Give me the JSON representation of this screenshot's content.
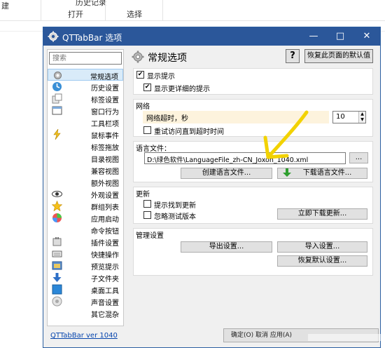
{
  "ribbon": {
    "left_label": "建",
    "history_label": "历史记录",
    "open_label": "打开",
    "select_label": "选择"
  },
  "dialog": {
    "title": "QTTabBar 选项",
    "minimize": "—",
    "maximize": "□",
    "close": "✕"
  },
  "sidebar": {
    "search_placeholder": "搜索",
    "items": [
      {
        "label": "常规选项",
        "icon": "gear-icon",
        "selected": true
      },
      {
        "label": "历史设置",
        "icon": "clock-icon"
      },
      {
        "label": "标签设置",
        "icon": "tabs-icon"
      },
      {
        "label": "窗口行为",
        "icon": "window-icon"
      },
      {
        "label": "工具栏项",
        "icon": "blank-icon"
      },
      {
        "label": "鼠标事件",
        "icon": "lightning-icon"
      },
      {
        "label": "标签拖放",
        "icon": "blank-icon"
      },
      {
        "label": "目录视图",
        "icon": "blank-icon"
      },
      {
        "label": "兼容视图",
        "icon": "blank-icon"
      },
      {
        "label": "额外视图",
        "icon": "blank-icon"
      },
      {
        "label": "外观设置",
        "icon": "eye-icon"
      },
      {
        "label": "群组列表",
        "icon": "star-icon"
      },
      {
        "label": "应用启动",
        "icon": "app-icon"
      },
      {
        "label": "命令按钮",
        "icon": "blank-icon"
      },
      {
        "label": "插件设置",
        "icon": "plugin-icon"
      },
      {
        "label": "快捷操作",
        "icon": "keyboard-icon"
      },
      {
        "label": "预览提示",
        "icon": "preview-icon"
      },
      {
        "label": "子文件夹",
        "icon": "arrow-down-icon"
      },
      {
        "label": "桌面工具",
        "icon": "desktop-icon"
      },
      {
        "label": "声音设置",
        "icon": "speaker-icon"
      },
      {
        "label": "其它混杂",
        "icon": "blank-icon"
      }
    ]
  },
  "header": {
    "title": "常规选项",
    "help_label": "?",
    "restore_label": "恢复此页面的默认值"
  },
  "tips": {
    "title": "显示提示",
    "checked": "✔",
    "show_detail": "显示更详细的提示"
  },
  "network": {
    "title": "网络",
    "timeout_label": "网络超时，秒",
    "timeout_value": "10",
    "retry_label": "重试访问直到超时时间"
  },
  "language": {
    "title": "语言文件：",
    "path": "D:\\绿色软件\\LanguageFile_zh-CN_Joxon_1040.xml",
    "browse_label": "...",
    "create_label": "创建语言文件...",
    "download_label": "下载语言文件..."
  },
  "update": {
    "title": "更新",
    "notify_label": "提示找到更新",
    "ignore_beta_label": "忽略测试版本",
    "download_now_label": "立即下载更新..."
  },
  "manage": {
    "title": "管理设置",
    "export_label": "导出设置...",
    "import_label": "导入设置...",
    "reset_label": "恢复默认设置..."
  },
  "footer": {
    "version_link": "QTTabBar ver 1040",
    "buttons_text": "确定(O)   取消   应用(A)"
  },
  "colors": {
    "titlebar": "#2b579a",
    "annotation": "#f2d200",
    "selected_bg": "#d9ebf9"
  }
}
